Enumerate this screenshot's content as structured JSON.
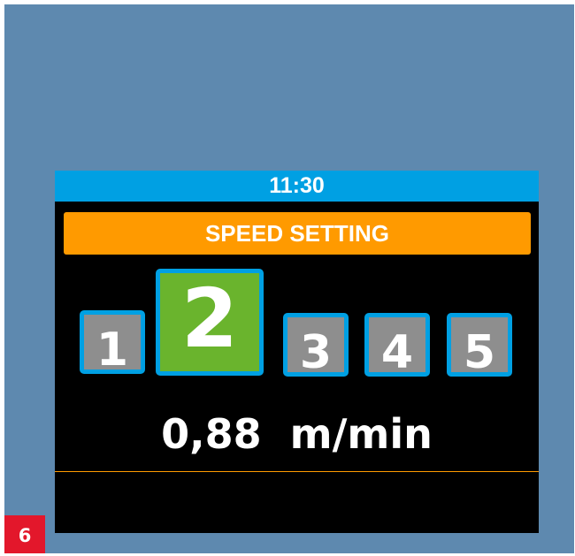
{
  "clock": {
    "time": "11:30"
  },
  "screen": {
    "title": "SPEED SETTING"
  },
  "speed_levels": [
    {
      "label": "1",
      "selected": false
    },
    {
      "label": "2",
      "selected": true
    },
    {
      "label": "3",
      "selected": false
    },
    {
      "label": "4",
      "selected": false
    },
    {
      "label": "5",
      "selected": false
    }
  ],
  "speed_readout": {
    "value": "0,88",
    "unit": "m/min"
  },
  "figure_badge": "6",
  "colors": {
    "background": "#5e89af",
    "clock_bar": "#00a0e3",
    "title_banner": "#ff9a00",
    "selected_level": "#6ab42d",
    "unselected_level": "#8e8e8e",
    "level_border": "#00a0e3",
    "badge": "#e3172b"
  }
}
